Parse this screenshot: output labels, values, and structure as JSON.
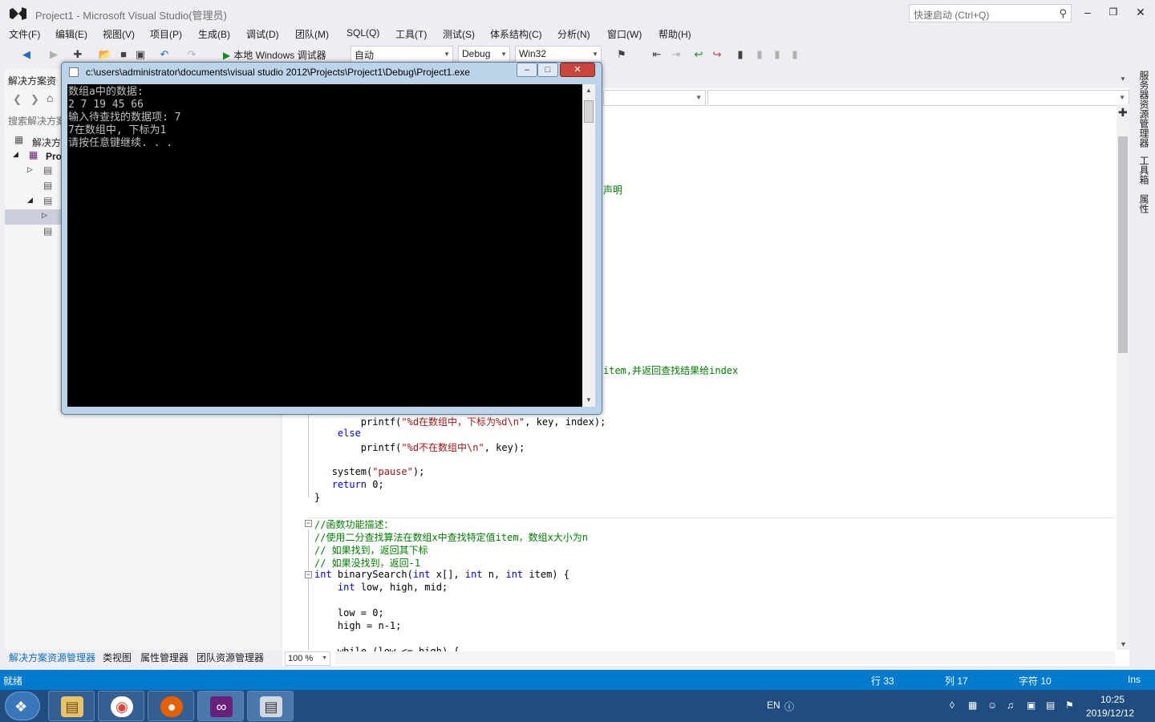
{
  "window": {
    "title": "Project1 - Microsoft Visual Studio(管理员)",
    "quicklaunch_placeholder": "快速启动 (Ctrl+Q)"
  },
  "menu": [
    "文件(F)",
    "编辑(E)",
    "视图(V)",
    "项目(P)",
    "生成(B)",
    "调试(D)",
    "团队(M)",
    "SQL(Q)",
    "工具(T)",
    "测试(S)",
    "体系结构(C)",
    "分析(N)",
    "窗口(W)",
    "帮助(H)"
  ],
  "toolbar": {
    "run_label": "本地 Windows 调试器",
    "run_mode": "自动",
    "config": "Debug",
    "platform": "Win32"
  },
  "solution_explorer": {
    "header": "解决方案资",
    "search_placeholder": "搜索解决方案",
    "items": [
      {
        "label": "解决方"
      },
      {
        "label": "Pro"
      }
    ],
    "tabs": [
      "解决方案资源管理器",
      "类视图",
      "属性管理器",
      "团队资源管理器"
    ]
  },
  "editor": {
    "partial_lines": [
      "声明",
      "item,并返回查找结果给index"
    ],
    "code": [
      {
        "indent": "        ",
        "parts": [
          {
            "t": "printf(",
            "c": ""
          },
          {
            "t": "\"%d在数组中，下标为%d\\n\"",
            "c": "st"
          },
          {
            "t": ", key, index);",
            "c": ""
          }
        ]
      },
      {
        "indent": "    ",
        "parts": [
          {
            "t": "else",
            "c": "kw"
          }
        ]
      },
      {
        "indent": "        ",
        "parts": [
          {
            "t": "printf(",
            "c": ""
          },
          {
            "t": "\"%d不在数组中\\n\"",
            "c": "st"
          },
          {
            "t": ", key);",
            "c": ""
          }
        ]
      },
      {
        "indent": "",
        "parts": []
      },
      {
        "indent": "   ",
        "parts": [
          {
            "t": "system(",
            "c": ""
          },
          {
            "t": "\"pause\"",
            "c": "st"
          },
          {
            "t": ");",
            "c": ""
          }
        ]
      },
      {
        "indent": "   ",
        "parts": [
          {
            "t": "return",
            "c": "kw"
          },
          {
            "t": " 0;",
            "c": ""
          }
        ]
      },
      {
        "indent": "",
        "parts": [
          {
            "t": "}",
            "c": ""
          }
        ]
      },
      {
        "indent": "",
        "parts": []
      },
      {
        "indent": "",
        "parts": [
          {
            "t": "//函数功能描述：",
            "c": "cm"
          }
        ]
      },
      {
        "indent": "",
        "parts": [
          {
            "t": "//使用二分查找算法在数组x中查找特定值item，数组x大小为n",
            "c": "cm"
          }
        ]
      },
      {
        "indent": "",
        "parts": [
          {
            "t": "// 如果找到，返回其下标",
            "c": "cm"
          }
        ]
      },
      {
        "indent": "",
        "parts": [
          {
            "t": "// 如果没找到，返回-1",
            "c": "cm"
          }
        ]
      },
      {
        "indent": "",
        "parts": [
          {
            "t": "int",
            "c": "kw"
          },
          {
            "t": " binarySearch(",
            "c": ""
          },
          {
            "t": "int",
            "c": "kw"
          },
          {
            "t": " x[], ",
            "c": ""
          },
          {
            "t": "int",
            "c": "kw"
          },
          {
            "t": " n, ",
            "c": ""
          },
          {
            "t": "int",
            "c": "kw"
          },
          {
            "t": " item) {",
            "c": ""
          }
        ]
      },
      {
        "indent": "    ",
        "parts": [
          {
            "t": "int",
            "c": "kw"
          },
          {
            "t": " low, high, mid;",
            "c": ""
          }
        ]
      },
      {
        "indent": "",
        "parts": []
      },
      {
        "indent": "    ",
        "parts": [
          {
            "t": "low = 0;",
            "c": ""
          }
        ]
      },
      {
        "indent": "    ",
        "parts": [
          {
            "t": "high = n-1;",
            "c": ""
          }
        ]
      },
      {
        "indent": "",
        "parts": []
      },
      {
        "indent": "    ",
        "parts": [
          {
            "t": "while (low <= high) {",
            "c": ""
          }
        ]
      }
    ],
    "zoom": "100 %"
  },
  "right_dock": [
    "服务器资源管理器",
    "工具箱",
    "属性"
  ],
  "console": {
    "title": "c:\\users\\administrator\\documents\\visual studio 2012\\Projects\\Project1\\Debug\\Project1.exe",
    "lines": [
      "数组a中的数据:",
      "2 7 19 45 66",
      "输入待查找的数据项: 7",
      "7在数组中, 下标为1",
      "请按任意键继续. . ."
    ]
  },
  "statusbar": {
    "ready": "就绪",
    "line": "行 33",
    "col": "列 17",
    "char": "字符 10",
    "mode": "Ins"
  },
  "taskbar": {
    "lang": "EN",
    "time": "10:25",
    "date": "2019/12/12"
  },
  "colors": {
    "accent": "#007acc",
    "keyword": "#0000ff",
    "comment": "#008000",
    "string": "#a31515"
  }
}
